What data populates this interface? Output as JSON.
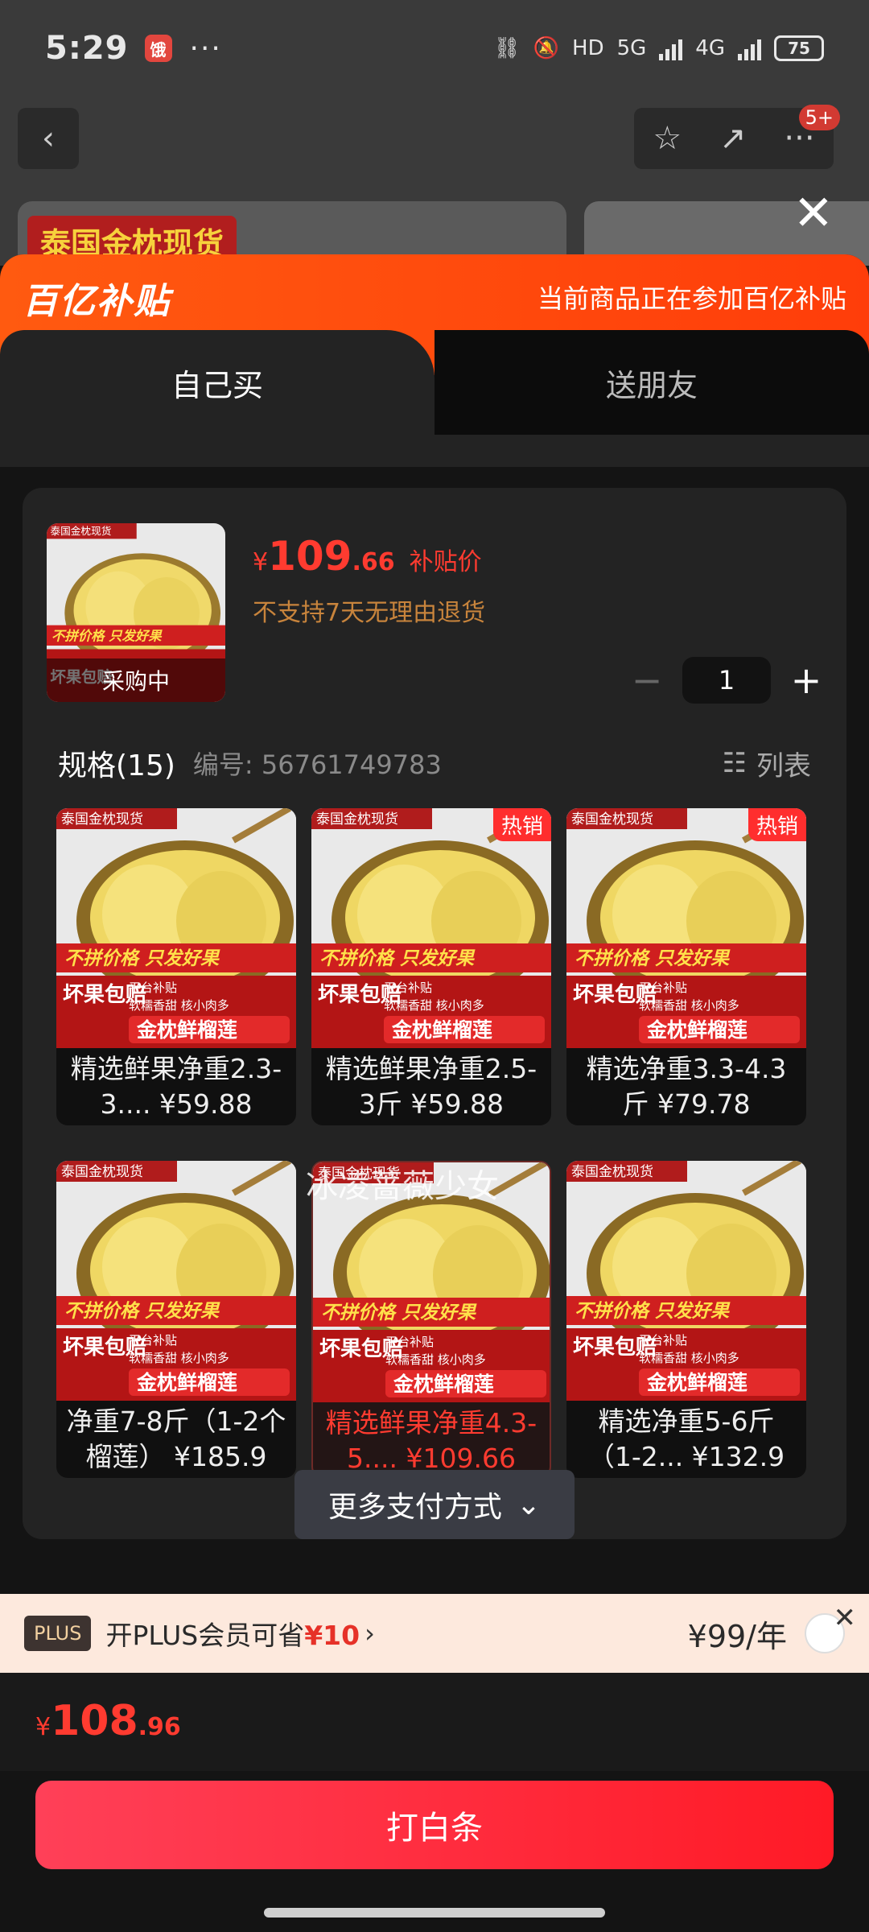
{
  "status_bar": {
    "time": "5:29",
    "app_badge": "饿",
    "more": "···",
    "hd": "HD",
    "net1": "5G",
    "net2": "4G",
    "battery": "75"
  },
  "nav": {
    "back": "‹",
    "star": "☆",
    "share": "↗",
    "more": "···",
    "badge": "5+"
  },
  "background": {
    "banner_text": "泰国金枕现货",
    "close": "✕"
  },
  "subsidy": {
    "logo": "百亿补贴",
    "notice": "当前商品正在参加百亿补贴"
  },
  "tabs": [
    {
      "label": "自己买",
      "active": true
    },
    {
      "label": "送朋友",
      "active": false
    }
  ],
  "product": {
    "price_symbol": "¥",
    "price_int": "109",
    "price_dec": ".66",
    "price_tag": "补贴价",
    "no_return": "不支持7天无理由退货",
    "buying_label": "采购中",
    "thumb_badge": "泰国金枕现货",
    "thumb_slogan": "不拼价格 只发好果",
    "thumb_bottom_left": "坏果包赔",
    "thumb_bottom_right": "金枕鲜榴莲",
    "thumb_sub1": "平台补贴",
    "thumb_sub2": "软糯香甜 核小肉多"
  },
  "quantity": {
    "minus": "−",
    "value": "1",
    "plus": "+"
  },
  "spec": {
    "title": "规格(15)",
    "code_label": "编号: 56761749783",
    "list_label": "列表"
  },
  "items": [
    {
      "label": "精选鲜果净重2.3-3.... ¥59.88",
      "hot": "",
      "selected": false
    },
    {
      "label": "精选鲜果净重2.5-3斤 ¥59.88",
      "hot": "热销",
      "selected": false
    },
    {
      "label": "精选净重3.3-4.3斤 ¥79.78",
      "hot": "热销",
      "selected": false
    },
    {
      "label": "净重7-8斤（1-2个榴莲） ¥185.9",
      "hot": "",
      "selected": false
    },
    {
      "label": "精选鲜果净重4.3-5.... ¥109.66",
      "hot": "",
      "selected": true
    },
    {
      "label": "精选净重5-6斤（1-2... ¥132.9",
      "hot": "",
      "selected": false
    }
  ],
  "watermark": "冰凌蔷薇少女",
  "more_pay": {
    "label": "更多支付方式",
    "arrow": "⌄"
  },
  "plus": {
    "logo": "PLUS",
    "text": "开PLUS会员可省",
    "save": "¥10",
    "arrow": "›",
    "price": "¥99/年",
    "close": "✕"
  },
  "total": {
    "symbol": "¥",
    "int": "108",
    "dec": ".96"
  },
  "pay_button": {
    "label": "打白条"
  },
  "colors": {
    "accent": "#ff3b30",
    "subsidy": "#ff4a0d",
    "sheet_bg": "#141414",
    "card_bg": "#232323"
  }
}
